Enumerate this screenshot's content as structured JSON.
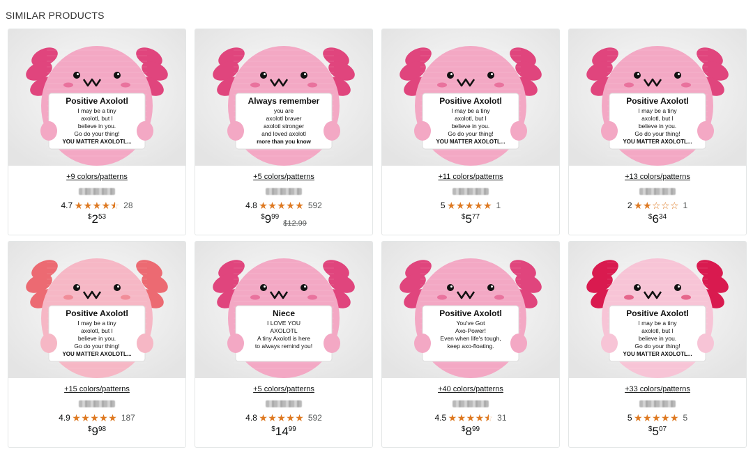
{
  "section": {
    "title": "SIMILAR PRODUCTS"
  },
  "products": [
    {
      "colors_link": "+9 colors/patterns",
      "rating": "4.7",
      "stars": [
        1,
        1,
        1,
        1,
        0.5
      ],
      "reviews": "28",
      "price": {
        "symbol": "$",
        "whole": "2",
        "fraction": "53"
      },
      "list_price": "",
      "image": {
        "body_color": "#f3a8c4",
        "gill_color": "#e0457d",
        "card_lines": [
          "Positive Axolotl",
          "I may be a tiny",
          "axolotl, but I",
          "believe in you.",
          "Go do your thing!",
          "YOU MATTER AXOLOTL..."
        ]
      }
    },
    {
      "colors_link": "+5 colors/patterns",
      "rating": "4.8",
      "stars": [
        1,
        1,
        1,
        1,
        1
      ],
      "reviews": "592",
      "price": {
        "symbol": "$",
        "whole": "9",
        "fraction": "99"
      },
      "list_price": "$12.99",
      "image": {
        "body_color": "#f3a8c4",
        "gill_color": "#e0457d",
        "card_lines": [
          "Always remember",
          "you are",
          "axolotl braver",
          "axolotl stronger",
          "and loved axolotl",
          "more than you know"
        ]
      }
    },
    {
      "colors_link": "+11 colors/patterns",
      "rating": "5",
      "stars": [
        1,
        1,
        1,
        1,
        1
      ],
      "reviews": "1",
      "price": {
        "symbol": "$",
        "whole": "5",
        "fraction": "77"
      },
      "list_price": "",
      "image": {
        "body_color": "#f3a8c4",
        "gill_color": "#e0457d",
        "card_lines": [
          "Positive Axolotl",
          "I may be a tiny",
          "axolotl, but I",
          "believe in you.",
          "Go do your thing!",
          "YOU MATTER AXOLOTL..."
        ]
      }
    },
    {
      "colors_link": "+13 colors/patterns",
      "rating": "2",
      "stars": [
        1,
        1,
        0,
        0,
        0
      ],
      "reviews": "1",
      "price": {
        "symbol": "$",
        "whole": "6",
        "fraction": "34"
      },
      "list_price": "",
      "image": {
        "body_color": "#f3a8c4",
        "gill_color": "#e0457d",
        "card_lines": [
          "Positive Axolotl",
          "I may be a tiny",
          "axolotl, but I",
          "believe in you.",
          "Go do your thing!",
          "YOU MATTER AXOLOTL..."
        ]
      }
    },
    {
      "colors_link": "+15 colors/patterns",
      "rating": "4.9",
      "stars": [
        1,
        1,
        1,
        1,
        1
      ],
      "reviews": "187",
      "price": {
        "symbol": "$",
        "whole": "9",
        "fraction": "98"
      },
      "list_price": "",
      "image": {
        "body_color": "#f6b7c5",
        "gill_color": "#ec6a72",
        "card_lines": [
          "Positive Axolotl",
          "I may be a tiny",
          "axolotl, but I",
          "believe in you.",
          "Go do your thing!",
          "YOU MATTER AXOLOTL..."
        ]
      }
    },
    {
      "colors_link": "+5 colors/patterns",
      "rating": "4.8",
      "stars": [
        1,
        1,
        1,
        1,
        1
      ],
      "reviews": "592",
      "price": {
        "symbol": "$",
        "whole": "14",
        "fraction": "99"
      },
      "list_price": "",
      "image": {
        "body_color": "#f3a8c4",
        "gill_color": "#e0457d",
        "card_lines": [
          "Niece",
          "I LOVE YOU",
          "AXOLOTL",
          "A tiny Axolotl is here",
          "to always remind you!",
          ""
        ]
      }
    },
    {
      "colors_link": "+40 colors/patterns",
      "rating": "4.5",
      "stars": [
        1,
        1,
        1,
        1,
        0.5
      ],
      "reviews": "31",
      "price": {
        "symbol": "$",
        "whole": "8",
        "fraction": "99"
      },
      "list_price": "",
      "image": {
        "body_color": "#f3a8c4",
        "gill_color": "#e0457d",
        "card_lines": [
          "Positive Axolotl",
          "You've Got",
          "Axo-Power!",
          "Even when life's tough,",
          "keep axo-floating.",
          ""
        ]
      }
    },
    {
      "colors_link": "+33 colors/patterns",
      "rating": "5",
      "stars": [
        1,
        1,
        1,
        1,
        1
      ],
      "reviews": "5",
      "price": {
        "symbol": "$",
        "whole": "5",
        "fraction": "07"
      },
      "list_price": "",
      "image": {
        "body_color": "#f7c4d6",
        "gill_color": "#d91a4f",
        "card_lines": [
          "Positive Axolotl",
          "I may be a tiny",
          "axolotl, but I",
          "believe in you.",
          "Go do your thing!",
          "YOU MATTER AXOLOTL..."
        ]
      }
    }
  ]
}
